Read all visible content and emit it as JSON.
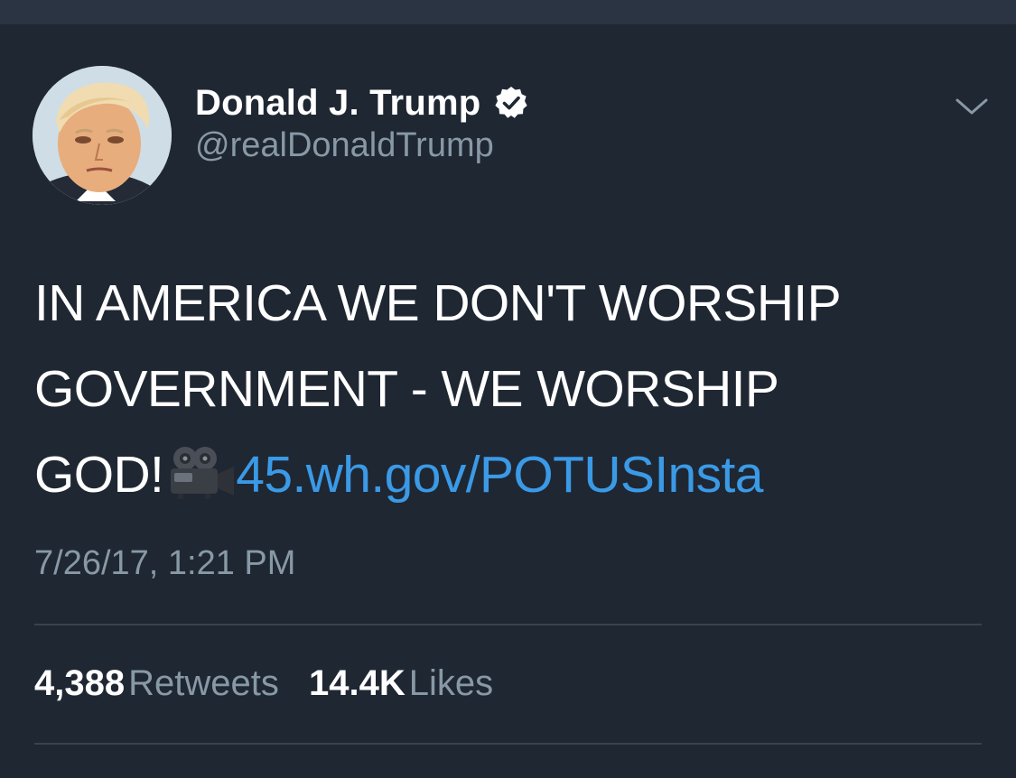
{
  "tweet": {
    "author": {
      "display_name": "Donald J. Trump",
      "handle": "@realDonaldTrump",
      "verified": true
    },
    "text_lines": [
      "IN AMERICA WE DON'T WORSHIP",
      "GOVERNMENT - WE WORSHIP",
      "GOD!"
    ],
    "emoji": "movie-camera-icon",
    "link_text": "45.wh.gov/POTUSInsta",
    "timestamp": "7/26/17, 1:21 PM",
    "stats": {
      "retweets_count": "4,388",
      "retweets_label": "Retweets",
      "likes_count": "14.4K",
      "likes_label": "Likes"
    }
  },
  "colors": {
    "background": "#1f2733",
    "top_strip": "#2a3442",
    "text": "#ffffff",
    "secondary_text": "#8899a6",
    "link": "#3b9ae6",
    "divider": "#38444d"
  }
}
